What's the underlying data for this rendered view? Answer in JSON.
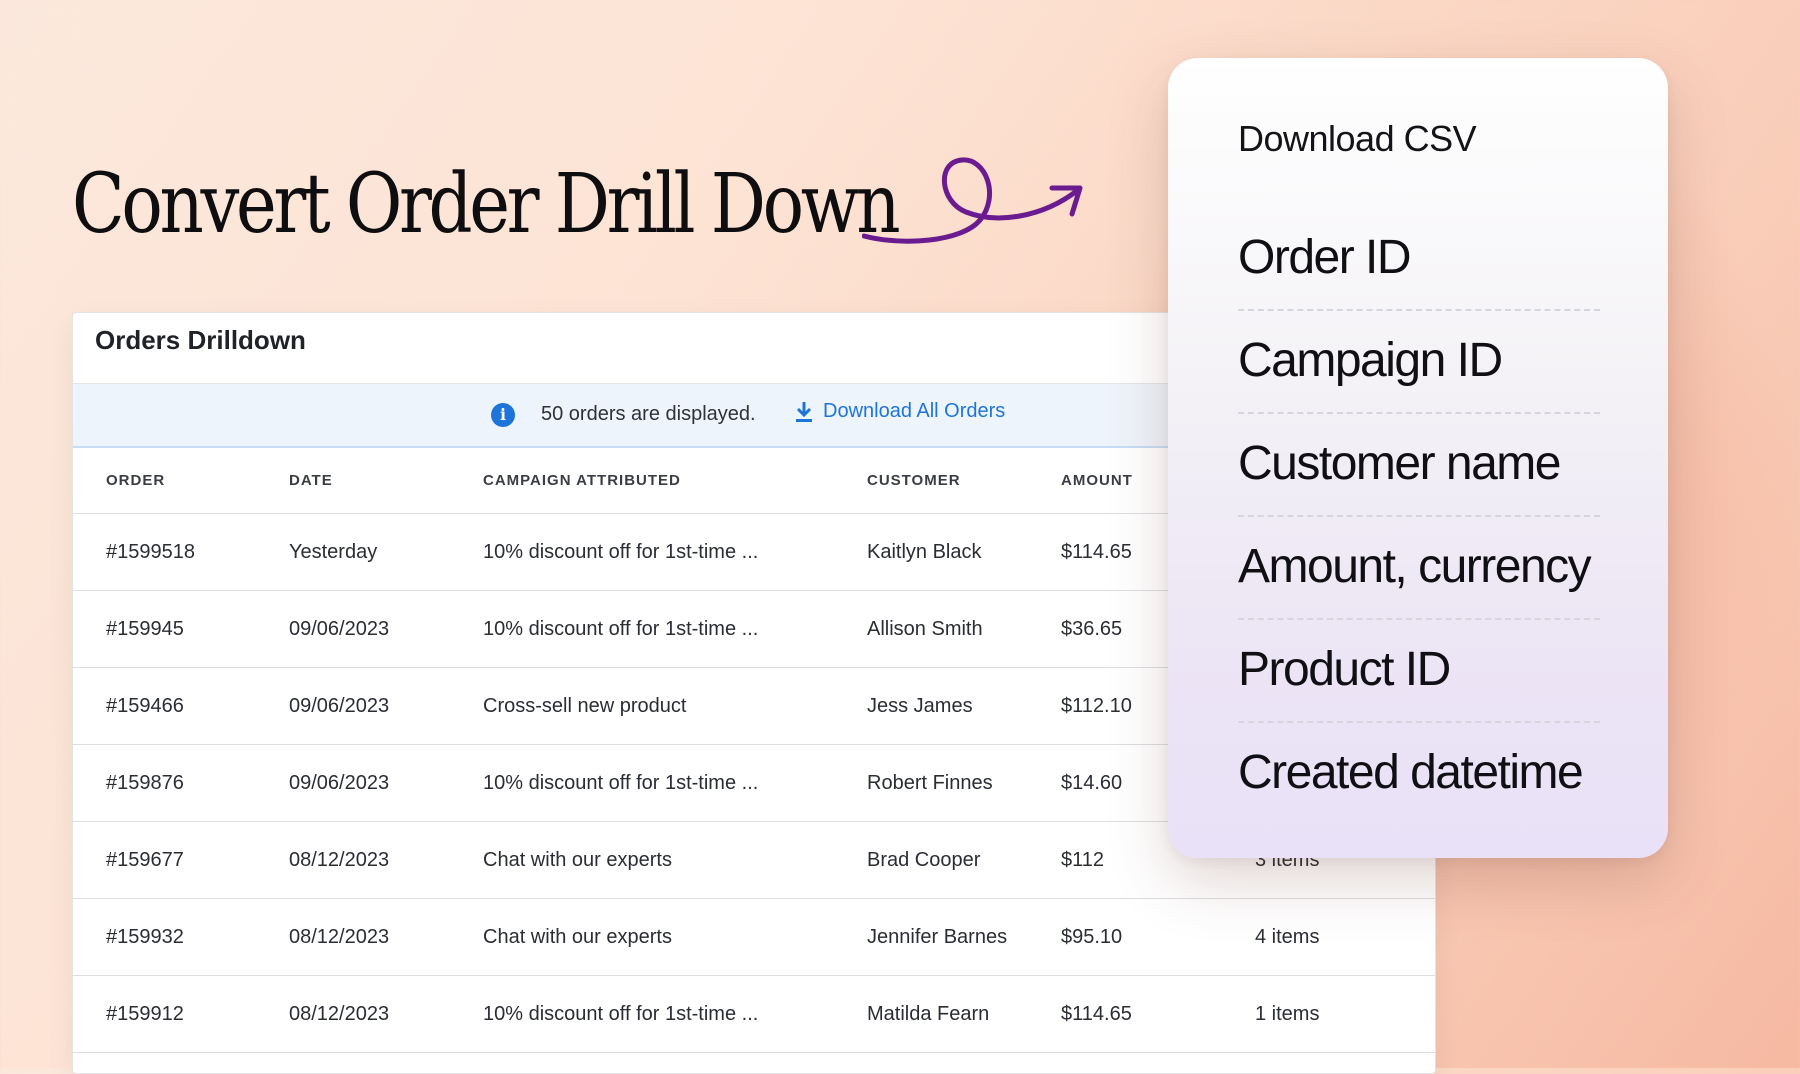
{
  "headline": "Convert Order Drill Down",
  "orders": {
    "title": "Orders Drilldown",
    "notice_text": "50 orders are displayed.",
    "download_label": "Download All Orders",
    "columns": [
      "ORDER",
      "DATE",
      "CAMPAIGN ATTRIBUTED",
      "CUSTOMER",
      "AMOUNT",
      ""
    ],
    "rows": [
      {
        "order": "#1599518",
        "date": "Yesterday",
        "campaign": "10% discount off for 1st-time ...",
        "customer": "Kaitlyn Black",
        "amount": "$114.65",
        "items": ""
      },
      {
        "order": "#159945",
        "date": "09/06/2023",
        "campaign": "10% discount off for 1st-time ...",
        "customer": "Allison Smith",
        "amount": "$36.65",
        "items": ""
      },
      {
        "order": "#159466",
        "date": "09/06/2023",
        "campaign": "Cross-sell new product",
        "customer": "Jess James",
        "amount": "$112.10",
        "items": ""
      },
      {
        "order": "#159876",
        "date": "09/06/2023",
        "campaign": "10% discount off for 1st-time ...",
        "customer": "Robert Finnes",
        "amount": "$14.60",
        "items": ""
      },
      {
        "order": "#159677",
        "date": "08/12/2023",
        "campaign": "Chat with our experts",
        "customer": "Brad Cooper",
        "amount": "$112",
        "items": "3 items"
      },
      {
        "order": "#159932",
        "date": "08/12/2023",
        "campaign": "Chat with our experts",
        "customer": "Jennifer Barnes",
        "amount": "$95.10",
        "items": "4 items"
      },
      {
        "order": "#159912",
        "date": "08/12/2023",
        "campaign": "10% discount off for 1st-time ...",
        "customer": "Matilda Fearn",
        "amount": "$114.65",
        "items": "1 items"
      }
    ]
  },
  "csv_card": {
    "title": "Download CSV",
    "fields": [
      "Order ID",
      "Campaign ID",
      "Customer name",
      "Amount, currency",
      "Product ID",
      "Created datetime"
    ]
  },
  "colors": {
    "accent_blue": "#1d74d9",
    "arrow_purple": "#6a1b8f",
    "background_peach": "#fde3d4"
  }
}
